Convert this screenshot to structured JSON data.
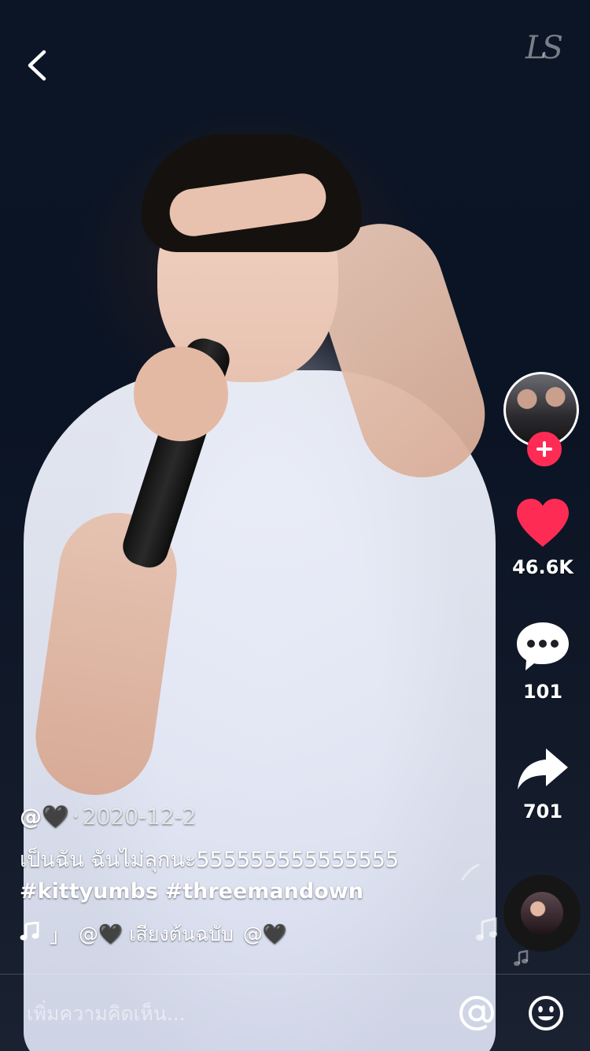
{
  "top_bar": {
    "back_icon": "chevron-left-icon",
    "watermark": "LS"
  },
  "rail": {
    "avatar_icon": "creator-avatar",
    "follow_icon": "plus-icon",
    "follow_color": "#fe2c55",
    "like": {
      "icon": "heart-icon",
      "count": "46.6K",
      "color": "#fe2c55"
    },
    "comment": {
      "icon": "comment-bubble-icon",
      "count": "101"
    },
    "share": {
      "icon": "share-arrow-icon",
      "count": "701"
    }
  },
  "caption": {
    "author": "@🖤",
    "separator": "·",
    "date": "2020-12-2",
    "text": "เป็นฉัน ฉันไม่ลุกนะ555555555555555",
    "hashtags": [
      "#kittyumbs",
      "#threemandown"
    ],
    "music": {
      "icon": "music-note-icon",
      "pre": "」",
      "credit": "@🖤 เสียงต้นฉบับ",
      "post": "@🖤"
    }
  },
  "music_disc": {
    "icon": "music-disc-icon"
  },
  "comment_bar": {
    "placeholder": "เพิ่มความคิดเห็น...",
    "mention_icon": "at-sign-icon",
    "emoji_icon": "emoji-smile-icon"
  }
}
